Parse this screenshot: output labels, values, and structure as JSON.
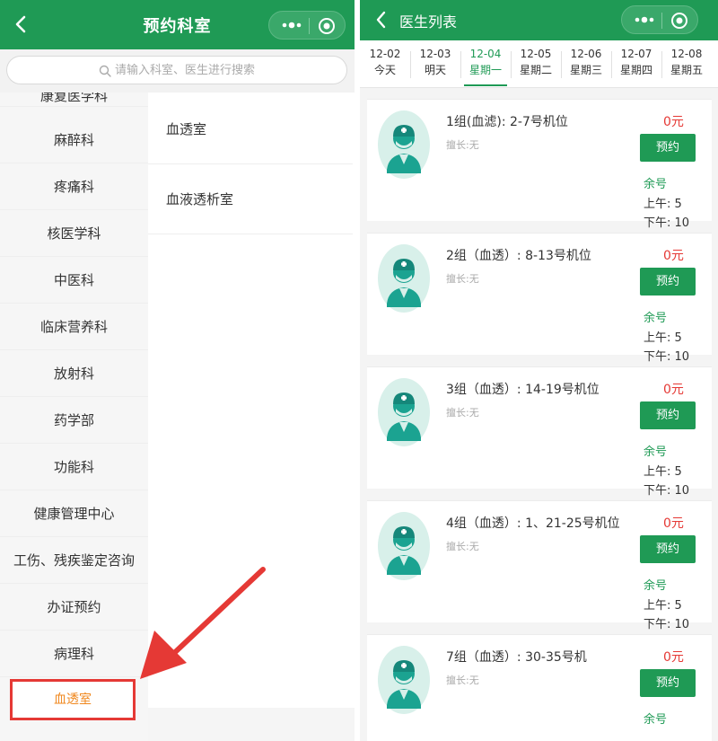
{
  "left": {
    "title": "预约科室",
    "search_placeholder": "请输入科室、医生进行搜索",
    "departments": [
      "康复医学科",
      "麻醉科",
      "疼痛科",
      "核医学科",
      "中医科",
      "临床营养科",
      "放射科",
      "药学部",
      "功能科",
      "健康管理中心",
      "工伤、残疾鉴定咨询",
      "办证预约",
      "病理科",
      "血透室"
    ],
    "active_department": "血透室",
    "sub_departments": [
      "血透室",
      "血液透析室"
    ]
  },
  "right": {
    "title": "医生列表",
    "dates": [
      {
        "date": "12-02",
        "weekday": "今天"
      },
      {
        "date": "12-03",
        "weekday": "明天"
      },
      {
        "date": "12-04",
        "weekday": "星期一"
      },
      {
        "date": "12-05",
        "weekday": "星期二"
      },
      {
        "date": "12-06",
        "weekday": "星期三"
      },
      {
        "date": "12-07",
        "weekday": "星期四"
      },
      {
        "date": "12-08",
        "weekday": "星期五"
      }
    ],
    "active_date": "12-04",
    "doctors": [
      {
        "name": "1组(血滤): 2-7号机位",
        "specialty": "擅长:无",
        "price": "0元",
        "book_label": "预约",
        "remain_label": "余号",
        "am": "上午: 5",
        "pm": "下午: 10"
      },
      {
        "name": "2组（血透）: 8-13号机位",
        "specialty": "擅长:无",
        "price": "0元",
        "book_label": "预约",
        "remain_label": "余号",
        "am": "上午: 5",
        "pm": "下午: 10"
      },
      {
        "name": "3组（血透）: 14-19号机位",
        "specialty": "擅长:无",
        "price": "0元",
        "book_label": "预约",
        "remain_label": "余号",
        "am": "上午: 5",
        "pm": "下午: 10"
      },
      {
        "name": "4组（血透）: 1、21-25号机位",
        "specialty": "擅长:无",
        "price": "0元",
        "book_label": "预约",
        "remain_label": "余号",
        "am": "上午: 5",
        "pm": "下午: 10"
      },
      {
        "name": "7组（血透）: 30-35号机",
        "specialty": "擅长:无",
        "price": "0元",
        "book_label": "预约",
        "remain_label": "余号",
        "am": "",
        "pm": ""
      }
    ]
  },
  "colors": {
    "brand_green": "#1f9a55",
    "accent_orange": "#f0881f",
    "price_red": "#e53935",
    "annotation_red": "#e53935",
    "avatar_bg": "#d8f0ea",
    "avatar_teal": "#1ba391"
  },
  "icons": {
    "back": "chevron-left-icon",
    "more": "more-dots-icon",
    "close": "target-circle-icon",
    "search": "search-icon",
    "avatar": "doctor-avatar-icon",
    "annotation": "red-arrow-annotation"
  }
}
